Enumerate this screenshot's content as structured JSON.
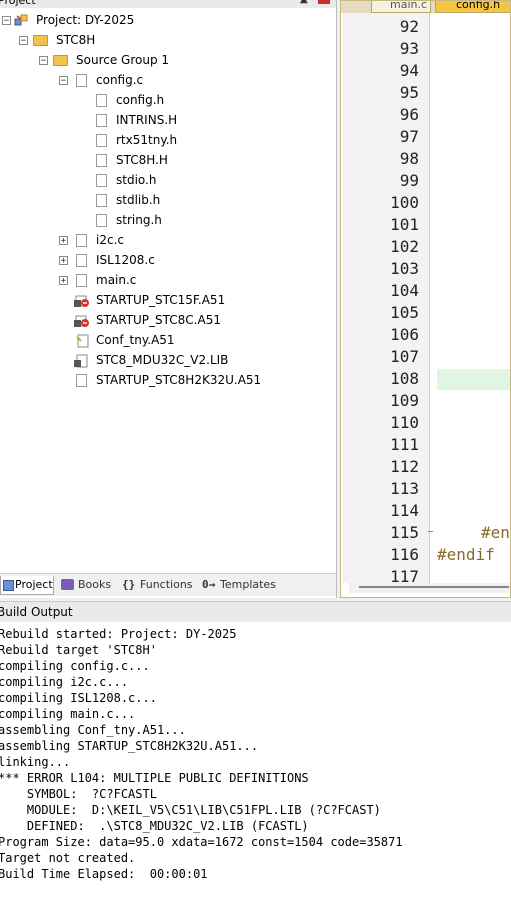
{
  "project_pane": {
    "title": "Project",
    "tree": {
      "root": "Project: DY-2025",
      "target": "STC8H",
      "group": "Source Group 1",
      "config_c": "config.c",
      "config_includes": [
        "config.h",
        "INTRINS.H",
        "rtx51tny.h",
        "STC8H.H",
        "stdio.h",
        "stdlib.h",
        "string.h"
      ],
      "files": [
        "i2c.c",
        "ISL1208.c",
        "main.c"
      ],
      "startup_15f": "STARTUP_STC15F.A51",
      "startup_8c": "STARTUP_STC8C.A51",
      "conf_tny": "Conf_tny.A51",
      "lib": "STC8_MDU32C_V2.LIB",
      "startup_8h": "STARTUP_STC8H2K32U.A51"
    },
    "tabs": {
      "project": "Project",
      "books": "Books",
      "functions": "Functions",
      "templates": "Templates"
    }
  },
  "editor": {
    "tabs": [
      "main.c",
      "config.h"
    ],
    "line_numbers": [
      "92",
      "93",
      "94",
      "95",
      "96",
      "97",
      "98",
      "99",
      "100",
      "101",
      "102",
      "103",
      "104",
      "105",
      "106",
      "107",
      "108",
      "109",
      "110",
      "111",
      "112",
      "113",
      "114",
      "115",
      "116",
      "117"
    ],
    "code_115": "#en",
    "code_116": "#endif"
  },
  "build_output": {
    "title": "Build Output",
    "lines": [
      "Rebuild started: Project: DY-2025",
      "Rebuild target 'STC8H'",
      "compiling config.c...",
      "compiling i2c.c...",
      "compiling ISL1208.c...",
      "compiling main.c...",
      "assembling Conf_tny.A51...",
      "assembling STARTUP_STC8H2K32U.A51...",
      "linking...",
      "*** ERROR L104: MULTIPLE PUBLIC DEFINITIONS",
      "    SYMBOL:  ?C?FCASTL",
      "    MODULE:  D:\\KEIL_V5\\C51\\LIB\\C51FPL.LIB (?C?FCAST)",
      "    DEFINED:  .\\STC8_MDU32C_V2.LIB (FCASTL)",
      "Program Size: data=95.0 xdata=1672 const=1504 code=35871",
      "Target not created.",
      "Build Time Elapsed:  00:00:01"
    ]
  }
}
